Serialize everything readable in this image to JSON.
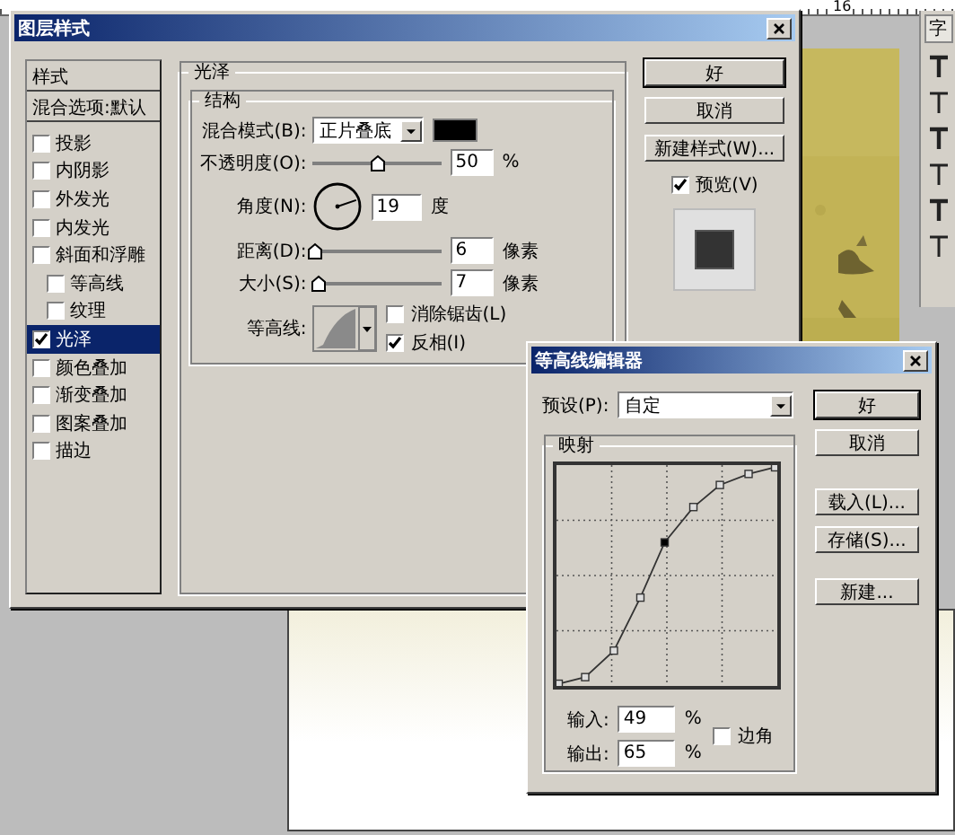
{
  "ruler": {
    "labels": [
      "16"
    ]
  },
  "tool_panel": {
    "tab": "字"
  },
  "layer_style_dialog": {
    "title": "图层样式",
    "style_list": {
      "header": "样式",
      "blending_options": "混合选项:默认",
      "items": [
        {
          "label": "投影",
          "checked": false,
          "selected": false
        },
        {
          "label": "内阴影",
          "checked": false,
          "selected": false
        },
        {
          "label": "外发光",
          "checked": false,
          "selected": false
        },
        {
          "label": "内发光",
          "checked": false,
          "selected": false
        },
        {
          "label": "斜面和浮雕",
          "checked": false,
          "selected": false,
          "children": [
            {
              "label": "等高线",
              "checked": false,
              "selected": false
            },
            {
              "label": "纹理",
              "checked": false,
              "selected": false
            }
          ]
        },
        {
          "label": "光泽",
          "checked": true,
          "selected": true
        },
        {
          "label": "颜色叠加",
          "checked": false,
          "selected": false
        },
        {
          "label": "渐变叠加",
          "checked": false,
          "selected": false
        },
        {
          "label": "图案叠加",
          "checked": false,
          "selected": false
        },
        {
          "label": "描边",
          "checked": false,
          "selected": false
        }
      ]
    },
    "satin": {
      "title": "光泽",
      "structure": {
        "title": "结构",
        "blend_mode": {
          "label": "混合模式(B):",
          "value": "正片叠底"
        },
        "opacity": {
          "label": "不透明度(O):",
          "level": 0.5,
          "value": "50",
          "unit": "%"
        },
        "angle": {
          "label": "角度(N):",
          "value": "19",
          "unit": "度"
        },
        "distance": {
          "label": "距离(D):",
          "level": 0.02,
          "value": "6",
          "unit": "像素"
        },
        "size": {
          "label": "大小(S):",
          "level": 0.04,
          "value": "7",
          "unit": "像素"
        },
        "contour": {
          "label": "等高线:",
          "anti_aliased": {
            "label": "消除锯齿(L)",
            "checked": false
          },
          "invert": {
            "label": "反相(I)",
            "checked": true
          }
        }
      }
    },
    "buttons": [
      "好",
      "取消",
      "新建样式(W)..."
    ],
    "preview": {
      "label": "预览(V)",
      "checked": true
    }
  },
  "contour_editor": {
    "title": "等高线编辑器",
    "preset": {
      "label": "预设(P):",
      "value": "自定"
    },
    "mapping": {
      "title": "映射",
      "input": {
        "label": "输入:",
        "value": "49",
        "unit": "%"
      },
      "output": {
        "label": "输出:",
        "value": "65",
        "unit": "%"
      },
      "corner": {
        "label": "边角",
        "checked": false
      }
    },
    "buttons": [
      "好",
      "取消",
      "载入(L)...",
      "存储(S)...",
      "新建..."
    ]
  }
}
